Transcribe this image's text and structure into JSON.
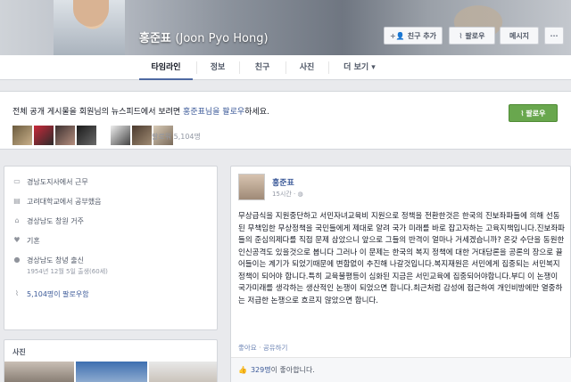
{
  "profile": {
    "name": "홍준표",
    "name_alt": "(Joon Pyo Hong)"
  },
  "header_buttons": {
    "add_friend": "친구 추가",
    "follow": "팔로우",
    "message": "메시지"
  },
  "tabs": [
    "타임라인",
    "정보",
    "친구",
    "사진",
    "더 보기"
  ],
  "banner": {
    "text_prefix": "전체 공개 게시물을 회원님의 뉴스피드에서 보려면 ",
    "text_link": "홍준표님을 팔로우",
    "text_suffix": "하세요.",
    "follow_button": "팔로우",
    "followers": "팔로워 5,104명"
  },
  "about": {
    "items": [
      {
        "icon": "briefcase-icon",
        "text": "경남도지사에서 근무",
        "sub": ""
      },
      {
        "icon": "school-icon",
        "text": "고려대학교에서 공부했음",
        "sub": ""
      },
      {
        "icon": "home-icon",
        "text": "경상남도 창원 거주",
        "sub": ""
      },
      {
        "icon": "heart-icon",
        "text": "기혼",
        "sub": ""
      },
      {
        "icon": "location-icon",
        "text": "경상남도 창녕 출신",
        "sub": "1954년 12월 5일 출생(60세)"
      },
      {
        "icon": "rss-icon",
        "text": "5,104명이 팔로우함",
        "sub": ""
      }
    ]
  },
  "photos": {
    "title": "사진"
  },
  "post": {
    "author": "홍준표",
    "time": "15시간 · ",
    "body": "무상급식을 지원중단하고 서민자녀교육비 지원으로 정책을 전환한것은 한국의 진보좌파들에 의해 선동된 무책임한 무상정책을 국민들에게 제대로 알려 국가 미래를 바로 잡고자하는 고육지책입니다.진보좌파들의 준심의제다를 직접 문제 삼았으니 앞으로 그들의 반격이 얼마나 거세겠습니까? 온갖 수단을 동원한 인신공격도 있을것으로 봅니다 그러나 이 문제는 한국의 복지 정책에 대한 거대담론을 공론의 장으로 끌어들이는 계기가 되었기때문에 변함없이 추진해 나갈것입니다.복지재원은 서민에게 집중되는 서민복지정책이 되어야 합니다.특히 교육불평등이 심화된 지금은 서민교육에 집중되어야합니다.부디 이 논쟁이 국가미래를 생각하는 생산적인 논쟁이 되었으면 합니다.최근처럼 감성에 접근하여 개인비방에만 열중하는 저급한 논쟁으로 흐르지 않았으면 합니다.",
    "like": "좋아요",
    "dot": " · ",
    "share": "공유하기",
    "likes_count": "329명",
    "likes_suffix": "이 좋아합니다."
  },
  "colors": {
    "link": "#3b5998",
    "green": "#69a74e",
    "bg": "#e9eaed"
  }
}
